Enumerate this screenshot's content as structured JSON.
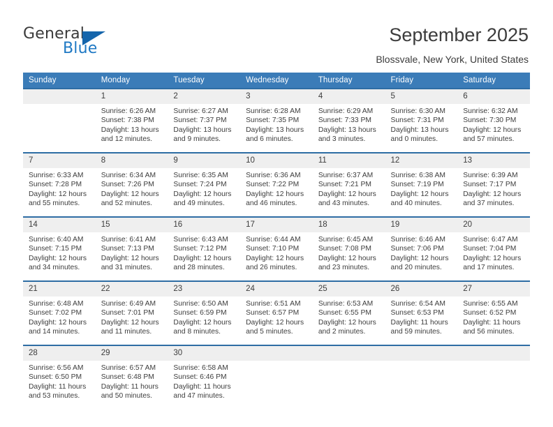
{
  "brand": {
    "name_top": "General",
    "name_bottom": "Blue",
    "colors": {
      "dark": "#3a3a3a",
      "blue": "#1f79c4",
      "triangle": "#1565ab"
    }
  },
  "header": {
    "title": "September 2025",
    "subtitle": "Blossvale, New York, United States"
  },
  "colors": {
    "header_bar": "#3b7cb8",
    "row_rule": "#2e6da4",
    "daynum_band": "#efefef",
    "text": "#3d3d3d"
  },
  "calendar": {
    "weekdays": [
      "Sunday",
      "Monday",
      "Tuesday",
      "Wednesday",
      "Thursday",
      "Friday",
      "Saturday"
    ],
    "weeks": [
      [
        {
          "day": ""
        },
        {
          "day": "1",
          "sunrise": "Sunrise: 6:26 AM",
          "sunset": "Sunset: 7:38 PM",
          "daylight_1": "Daylight: 13 hours",
          "daylight_2": "and 12 minutes."
        },
        {
          "day": "2",
          "sunrise": "Sunrise: 6:27 AM",
          "sunset": "Sunset: 7:37 PM",
          "daylight_1": "Daylight: 13 hours",
          "daylight_2": "and 9 minutes."
        },
        {
          "day": "3",
          "sunrise": "Sunrise: 6:28 AM",
          "sunset": "Sunset: 7:35 PM",
          "daylight_1": "Daylight: 13 hours",
          "daylight_2": "and 6 minutes."
        },
        {
          "day": "4",
          "sunrise": "Sunrise: 6:29 AM",
          "sunset": "Sunset: 7:33 PM",
          "daylight_1": "Daylight: 13 hours",
          "daylight_2": "and 3 minutes."
        },
        {
          "day": "5",
          "sunrise": "Sunrise: 6:30 AM",
          "sunset": "Sunset: 7:31 PM",
          "daylight_1": "Daylight: 13 hours",
          "daylight_2": "and 0 minutes."
        },
        {
          "day": "6",
          "sunrise": "Sunrise: 6:32 AM",
          "sunset": "Sunset: 7:30 PM",
          "daylight_1": "Daylight: 12 hours",
          "daylight_2": "and 57 minutes."
        }
      ],
      [
        {
          "day": "7",
          "sunrise": "Sunrise: 6:33 AM",
          "sunset": "Sunset: 7:28 PM",
          "daylight_1": "Daylight: 12 hours",
          "daylight_2": "and 55 minutes."
        },
        {
          "day": "8",
          "sunrise": "Sunrise: 6:34 AM",
          "sunset": "Sunset: 7:26 PM",
          "daylight_1": "Daylight: 12 hours",
          "daylight_2": "and 52 minutes."
        },
        {
          "day": "9",
          "sunrise": "Sunrise: 6:35 AM",
          "sunset": "Sunset: 7:24 PM",
          "daylight_1": "Daylight: 12 hours",
          "daylight_2": "and 49 minutes."
        },
        {
          "day": "10",
          "sunrise": "Sunrise: 6:36 AM",
          "sunset": "Sunset: 7:22 PM",
          "daylight_1": "Daylight: 12 hours",
          "daylight_2": "and 46 minutes."
        },
        {
          "day": "11",
          "sunrise": "Sunrise: 6:37 AM",
          "sunset": "Sunset: 7:21 PM",
          "daylight_1": "Daylight: 12 hours",
          "daylight_2": "and 43 minutes."
        },
        {
          "day": "12",
          "sunrise": "Sunrise: 6:38 AM",
          "sunset": "Sunset: 7:19 PM",
          "daylight_1": "Daylight: 12 hours",
          "daylight_2": "and 40 minutes."
        },
        {
          "day": "13",
          "sunrise": "Sunrise: 6:39 AM",
          "sunset": "Sunset: 7:17 PM",
          "daylight_1": "Daylight: 12 hours",
          "daylight_2": "and 37 minutes."
        }
      ],
      [
        {
          "day": "14",
          "sunrise": "Sunrise: 6:40 AM",
          "sunset": "Sunset: 7:15 PM",
          "daylight_1": "Daylight: 12 hours",
          "daylight_2": "and 34 minutes."
        },
        {
          "day": "15",
          "sunrise": "Sunrise: 6:41 AM",
          "sunset": "Sunset: 7:13 PM",
          "daylight_1": "Daylight: 12 hours",
          "daylight_2": "and 31 minutes."
        },
        {
          "day": "16",
          "sunrise": "Sunrise: 6:43 AM",
          "sunset": "Sunset: 7:12 PM",
          "daylight_1": "Daylight: 12 hours",
          "daylight_2": "and 28 minutes."
        },
        {
          "day": "17",
          "sunrise": "Sunrise: 6:44 AM",
          "sunset": "Sunset: 7:10 PM",
          "daylight_1": "Daylight: 12 hours",
          "daylight_2": "and 26 minutes."
        },
        {
          "day": "18",
          "sunrise": "Sunrise: 6:45 AM",
          "sunset": "Sunset: 7:08 PM",
          "daylight_1": "Daylight: 12 hours",
          "daylight_2": "and 23 minutes."
        },
        {
          "day": "19",
          "sunrise": "Sunrise: 6:46 AM",
          "sunset": "Sunset: 7:06 PM",
          "daylight_1": "Daylight: 12 hours",
          "daylight_2": "and 20 minutes."
        },
        {
          "day": "20",
          "sunrise": "Sunrise: 6:47 AM",
          "sunset": "Sunset: 7:04 PM",
          "daylight_1": "Daylight: 12 hours",
          "daylight_2": "and 17 minutes."
        }
      ],
      [
        {
          "day": "21",
          "sunrise": "Sunrise: 6:48 AM",
          "sunset": "Sunset: 7:02 PM",
          "daylight_1": "Daylight: 12 hours",
          "daylight_2": "and 14 minutes."
        },
        {
          "day": "22",
          "sunrise": "Sunrise: 6:49 AM",
          "sunset": "Sunset: 7:01 PM",
          "daylight_1": "Daylight: 12 hours",
          "daylight_2": "and 11 minutes."
        },
        {
          "day": "23",
          "sunrise": "Sunrise: 6:50 AM",
          "sunset": "Sunset: 6:59 PM",
          "daylight_1": "Daylight: 12 hours",
          "daylight_2": "and 8 minutes."
        },
        {
          "day": "24",
          "sunrise": "Sunrise: 6:51 AM",
          "sunset": "Sunset: 6:57 PM",
          "daylight_1": "Daylight: 12 hours",
          "daylight_2": "and 5 minutes."
        },
        {
          "day": "25",
          "sunrise": "Sunrise: 6:53 AM",
          "sunset": "Sunset: 6:55 PM",
          "daylight_1": "Daylight: 12 hours",
          "daylight_2": "and 2 minutes."
        },
        {
          "day": "26",
          "sunrise": "Sunrise: 6:54 AM",
          "sunset": "Sunset: 6:53 PM",
          "daylight_1": "Daylight: 11 hours",
          "daylight_2": "and 59 minutes."
        },
        {
          "day": "27",
          "sunrise": "Sunrise: 6:55 AM",
          "sunset": "Sunset: 6:52 PM",
          "daylight_1": "Daylight: 11 hours",
          "daylight_2": "and 56 minutes."
        }
      ],
      [
        {
          "day": "28",
          "sunrise": "Sunrise: 6:56 AM",
          "sunset": "Sunset: 6:50 PM",
          "daylight_1": "Daylight: 11 hours",
          "daylight_2": "and 53 minutes."
        },
        {
          "day": "29",
          "sunrise": "Sunrise: 6:57 AM",
          "sunset": "Sunset: 6:48 PM",
          "daylight_1": "Daylight: 11 hours",
          "daylight_2": "and 50 minutes."
        },
        {
          "day": "30",
          "sunrise": "Sunrise: 6:58 AM",
          "sunset": "Sunset: 6:46 PM",
          "daylight_1": "Daylight: 11 hours",
          "daylight_2": "and 47 minutes."
        },
        {
          "day": ""
        },
        {
          "day": ""
        },
        {
          "day": ""
        },
        {
          "day": ""
        }
      ]
    ]
  }
}
